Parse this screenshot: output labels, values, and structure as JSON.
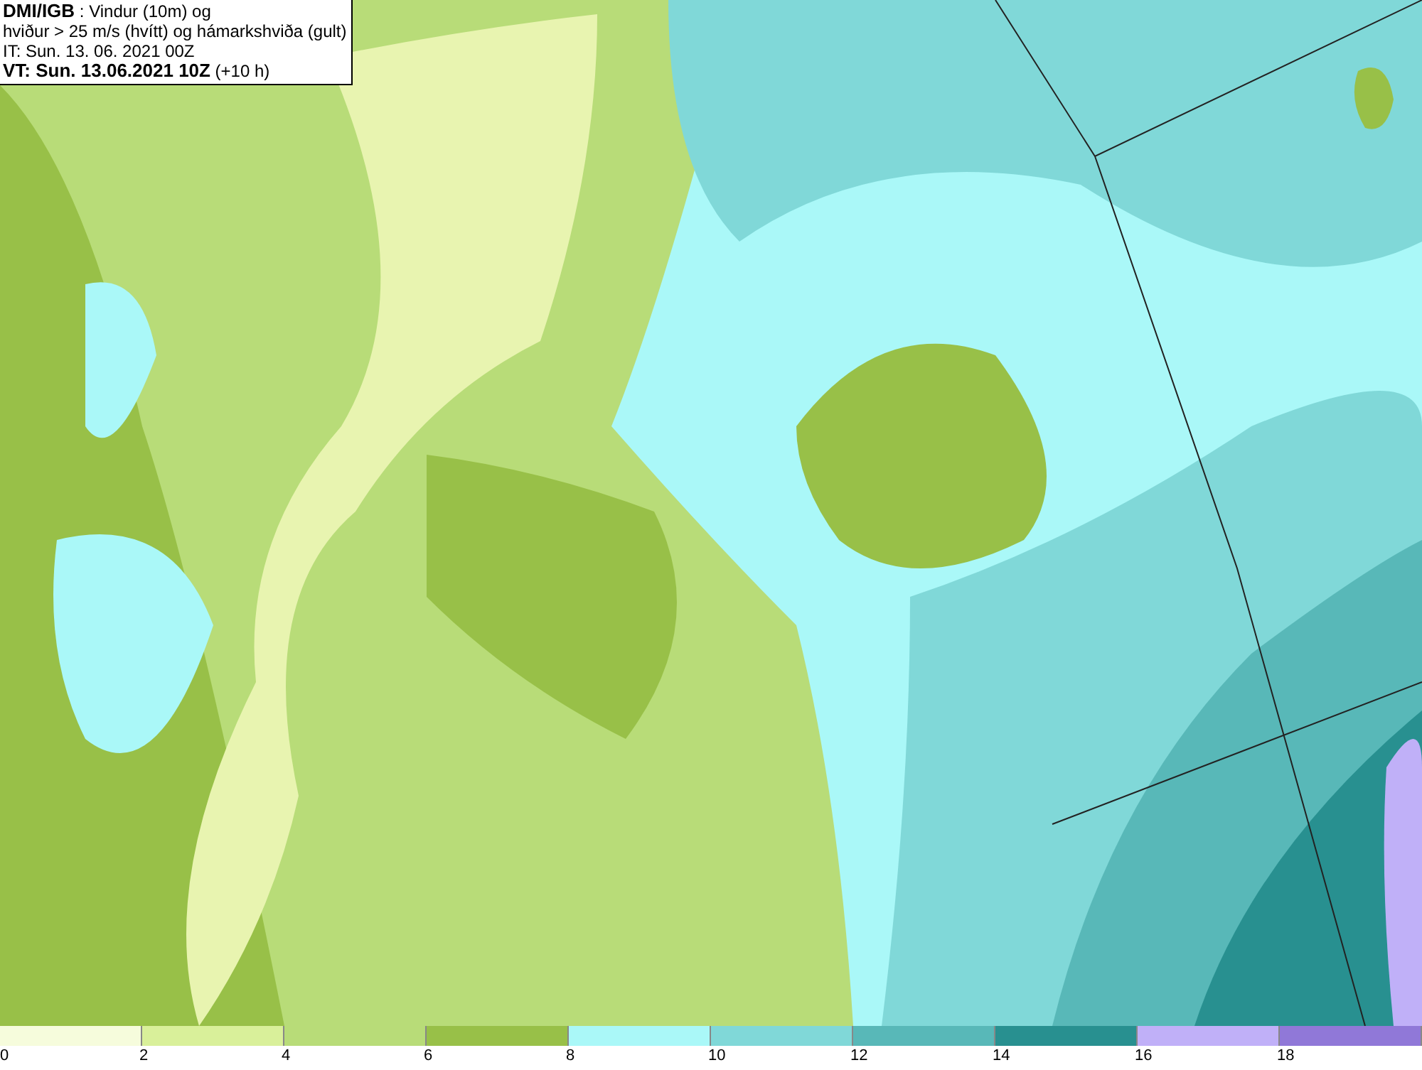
{
  "header": {
    "lines": [
      "**DMI/IGB** : Vindur (10m) og",
      "hviður > 25 m/s (hvítt) og hámarkshviða (gult)",
      "IT: Sun. 13. 06. 2021 00Z",
      "**VT: Sun. 13.06.2021 10Z** (+10 h)"
    ]
  },
  "legend": {
    "bins": [
      {
        "label": "0",
        "color": "#f6fcdc"
      },
      {
        "label": "2",
        "color": "#d9f09a"
      },
      {
        "label": "4",
        "color": "#b8dc78"
      },
      {
        "label": "6",
        "color": "#98c048"
      },
      {
        "label": "8",
        "color": "#aaf8f8"
      },
      {
        "label": "10",
        "color": "#80d8d8"
      },
      {
        "label": "12",
        "color": "#58b8b8"
      },
      {
        "label": "14",
        "color": "#289090"
      },
      {
        "label": "16",
        "color": "#c0b0f8"
      },
      {
        "label": "18",
        "color": "#9078d8"
      }
    ]
  }
}
